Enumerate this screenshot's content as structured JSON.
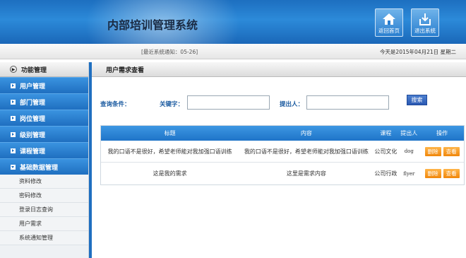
{
  "header": {
    "title": "内部培训管理系统",
    "home_label": "返回首页",
    "exit_label": "退出系统"
  },
  "notice": {
    "message": "[最近系统通知：05-26]",
    "date_text": "今天是2015年04月21日 星期二"
  },
  "sidebar": {
    "title": "功能管理",
    "items": [
      {
        "label": "用户管理"
      },
      {
        "label": "部门管理"
      },
      {
        "label": "岗位管理"
      },
      {
        "label": "级别管理"
      },
      {
        "label": "课程管理"
      },
      {
        "label": "基础数据管理"
      }
    ],
    "sub_items": [
      {
        "label": "资料修改"
      },
      {
        "label": "密码修改"
      },
      {
        "label": "登录日志查询"
      },
      {
        "label": "用户需求"
      },
      {
        "label": "系统通知管理"
      }
    ]
  },
  "main": {
    "title": "用户需求查看",
    "search": {
      "condition_label": "查询条件：",
      "keyword_label": "关键字：",
      "keyword_value": "",
      "proposer_label": "提出人：",
      "proposer_value": "",
      "button_label": "搜索"
    },
    "table": {
      "columns": [
        "标题",
        "内容",
        "课程",
        "提出人",
        "操作"
      ],
      "rows": [
        {
          "title": "我的口语不是很好，希望老师能对我加强口语训练",
          "content": "我的口语不是很好，希望老师能对我加强口语训练",
          "course": "公司文化",
          "person": "dog",
          "delete": "删除",
          "view": "查看"
        },
        {
          "title": "这是我的需求",
          "content": "这里是需求内容",
          "course": "公司行政",
          "person": "flyer",
          "delete": "删除",
          "view": "查看"
        }
      ]
    }
  },
  "colors": {
    "brand_blue": "#1f6fc0",
    "action_orange": "#f0860a",
    "label_blue": "#1a5aa0"
  }
}
